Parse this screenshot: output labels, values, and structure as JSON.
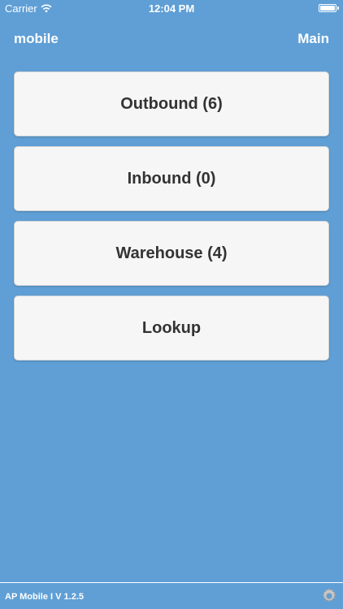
{
  "status_bar": {
    "carrier": "Carrier",
    "time": "12:04 PM",
    "icons": [
      "wifi-icon",
      "battery-icon"
    ]
  },
  "nav": {
    "left_label": "mobile",
    "right_label": "Main"
  },
  "menu": {
    "items": [
      {
        "label": "Outbound (6)"
      },
      {
        "label": "Inbound (0)"
      },
      {
        "label": "Warehouse (4)"
      },
      {
        "label": "Lookup"
      }
    ]
  },
  "footer": {
    "version": "AP Mobile I V 1.2.5",
    "icon": "gear-icon"
  },
  "colors": {
    "background": "#5f9fd6",
    "button_background": "#f6f6f6",
    "button_text": "#333333",
    "foreground": "#ffffff"
  }
}
